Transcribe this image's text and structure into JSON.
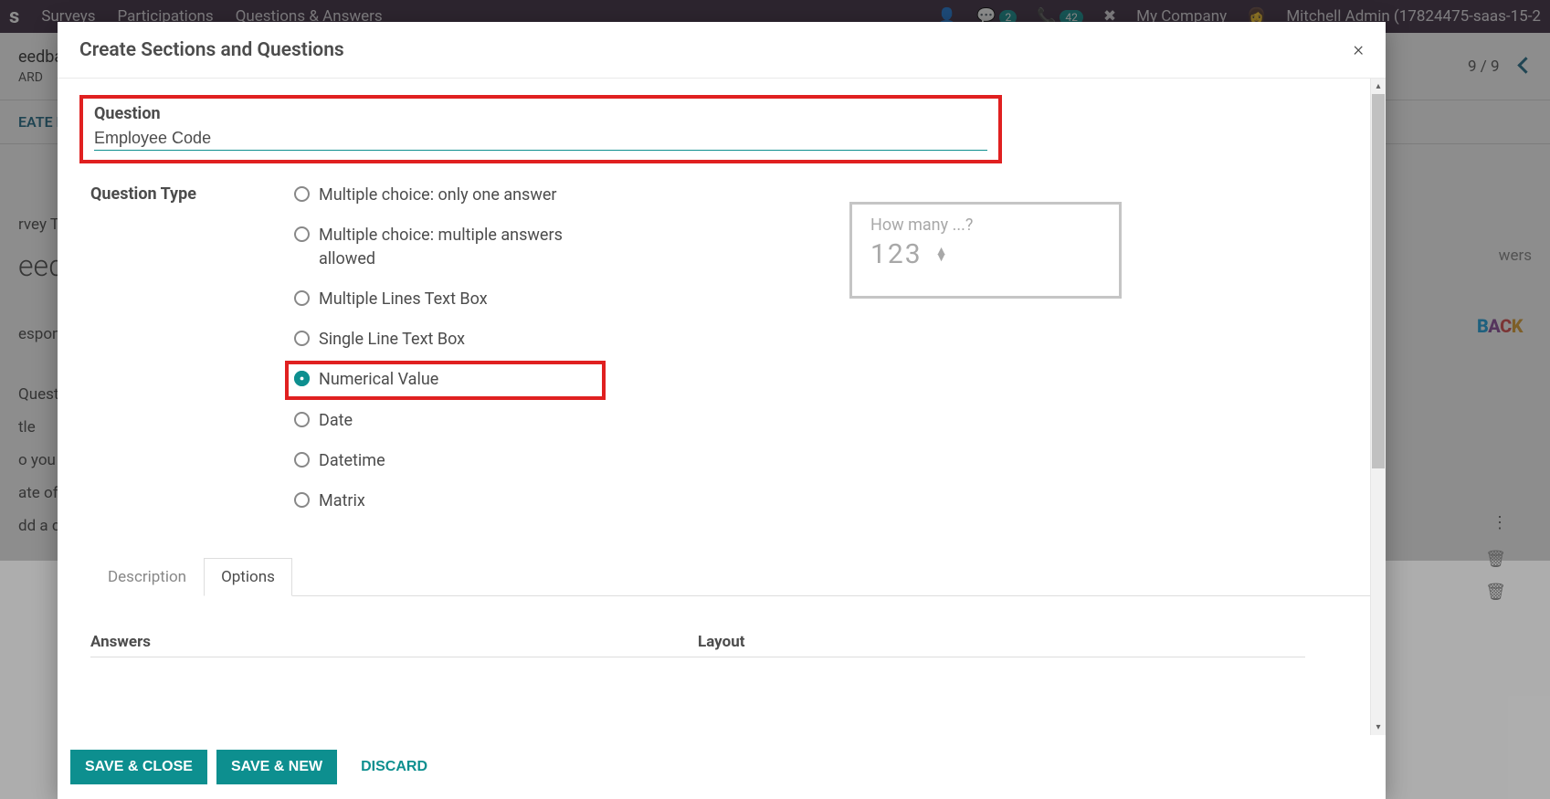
{
  "bg": {
    "topbar": {
      "brand_suffix": "s",
      "nav": [
        "Surveys",
        "Participations",
        "Questions & Answers"
      ],
      "badge1": "2",
      "badge2": "42",
      "company": "My Company",
      "user": "Mitchell Admin (17824475-saas-15-2"
    },
    "breadcrumb": "eedba",
    "pager": "9 / 9",
    "buttons": [
      "ARD",
      "EATE LI"
    ],
    "rows": [
      "rvey Tit",
      "eed",
      "esponsi",
      "Questi",
      "tle",
      "o you h",
      "ate of E",
      "dd a qu"
    ],
    "right_label": "wers",
    "feedback_img": "BACK"
  },
  "modal": {
    "title": "Create Sections and Questions",
    "question_label": "Question",
    "question_value": "Employee Code",
    "type_label": "Question Type",
    "types": [
      "Multiple choice: only one answer",
      "Multiple choice: multiple answers allowed",
      "Multiple Lines Text Box",
      "Single Line Text Box",
      "Numerical Value",
      "Date",
      "Datetime",
      "Matrix"
    ],
    "selected_type_index": 4,
    "highlighted_type_index": 4,
    "preview": {
      "hint": "How many ...?",
      "value": "123"
    },
    "tabs": {
      "description": "Description",
      "options": "Options",
      "active": "options"
    },
    "sections": {
      "answers": "Answers",
      "layout": "Layout"
    },
    "footer": {
      "save_close": "SAVE & CLOSE",
      "save_new": "SAVE & NEW",
      "discard": "DISCARD"
    }
  }
}
